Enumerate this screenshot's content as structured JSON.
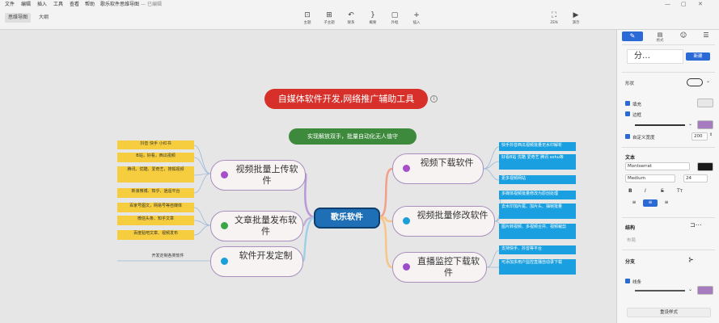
{
  "menu": [
    "文件",
    "编辑",
    "插入",
    "工具",
    "查看",
    "帮助",
    "歌乐软件思维导图",
    "—",
    "已编辑"
  ],
  "window_controls": [
    "—",
    "▢",
    "✕"
  ],
  "tabs": [
    "思维导图",
    "大纲"
  ],
  "toolbar": [
    {
      "icon": "topic-icon",
      "glyph": "⊡",
      "label": "主题"
    },
    {
      "icon": "subtopic-icon",
      "glyph": "⊞",
      "label": "子主题"
    },
    {
      "icon": "relation-icon",
      "glyph": "↶",
      "label": "联系"
    },
    {
      "icon": "summary-icon",
      "glyph": "}",
      "label": "概要"
    },
    {
      "icon": "boundary-icon",
      "glyph": "▢",
      "label": "外框"
    },
    {
      "icon": "insert-icon",
      "glyph": "+",
      "label": "插入"
    },
    {
      "icon": "zen-icon",
      "glyph": "⛶",
      "label": "ZEN"
    },
    {
      "icon": "present-icon",
      "glyph": "▶",
      "label": "演示"
    }
  ],
  "panel": {
    "tabs": [
      {
        "icon": "style-icon",
        "glyph": "✎"
      },
      {
        "icon": "format-icon",
        "glyph": "▤",
        "label": "格式"
      },
      {
        "icon": "icon-tab-icon",
        "glyph": "☺"
      },
      {
        "icon": "notes-icon",
        "glyph": "☰"
      }
    ],
    "style_value": "分…",
    "style_new_button": "新建",
    "shape_label": "形状",
    "fill_label": "填充",
    "border_label": "边框",
    "custom_width_label": "自定义宽度",
    "custom_width_value": "200",
    "text_section": "文本",
    "font_family": "Montserrat",
    "font_weight": "Medium",
    "font_size": "24",
    "text_format_buttons": [
      "B",
      "I",
      "S",
      "Tт"
    ],
    "structure_section": "结构",
    "structure_value": "布局",
    "branch_section": "分支",
    "line_label": "线条",
    "reset_style": "重设样式",
    "colors": {
      "accent": "#2b6ad6",
      "fill_swatch": "#e8e8e8",
      "border_swatch": "#a77bc0",
      "text_swatch": "#1a1a1a",
      "line_swatch": "#a77bc0"
    }
  },
  "mindmap": {
    "title": "自媒体软件开发,网络推广辅助工具",
    "subtitle": "实现解放双手，批量自动化无人值守",
    "center": "歌乐软件",
    "branches": [
      {
        "label": "视频批量上传软件",
        "dot": "#a64fc8",
        "leaves": [
          "抖音 快手 小红书",
          "B站，好看，西瓜视频",
          "腾讯、优酷、爱奇艺，搜狐视频",
          "新浪微博、知乎、逍遥平台"
        ]
      },
      {
        "label": "文章批量发布软件",
        "dot": "#3ba645",
        "leaves": [
          "百家号图文，网易号等自媒体",
          "微信头条、知乎文章",
          "百度贴吧文章、视频发布"
        ]
      },
      {
        "label": "软件开发定制",
        "dot": "#1a9fd8",
        "leaves": [
          "开发定制各类软件"
        ]
      },
      {
        "label": "视频下载软件",
        "dot": "#a64fc8",
        "leaves": [
          "快手抖音西瓜视频批量无水印解析",
          "好看B站 优酷 爱奇艺 腾讯 sohu等",
          "更多视频网站"
        ]
      },
      {
        "label": "视频批量修改软件",
        "dot": "#1a9fd8",
        "leaves": [
          "多媒体视频批量修改为原创处理",
          "去水印加片尾、加片头、抽帧批量",
          "图片转视频、多视频合并、视频裁剪"
        ]
      },
      {
        "label": "直播监控下载软件",
        "dot": "#9c4dc8",
        "leaves": [
          "支持快手、抖音等平台",
          "可添加多用户监控直播自动录下载"
        ]
      }
    ]
  },
  "colors": {
    "title_bg": "#d7302b",
    "subtitle_bg": "#3d8a3d",
    "center_bg": "#1e6fb5",
    "leaf_yellow": "#f6cd3f",
    "leaf_blue": "#1aa0e0",
    "bubble_border": "#a88fbe"
  }
}
